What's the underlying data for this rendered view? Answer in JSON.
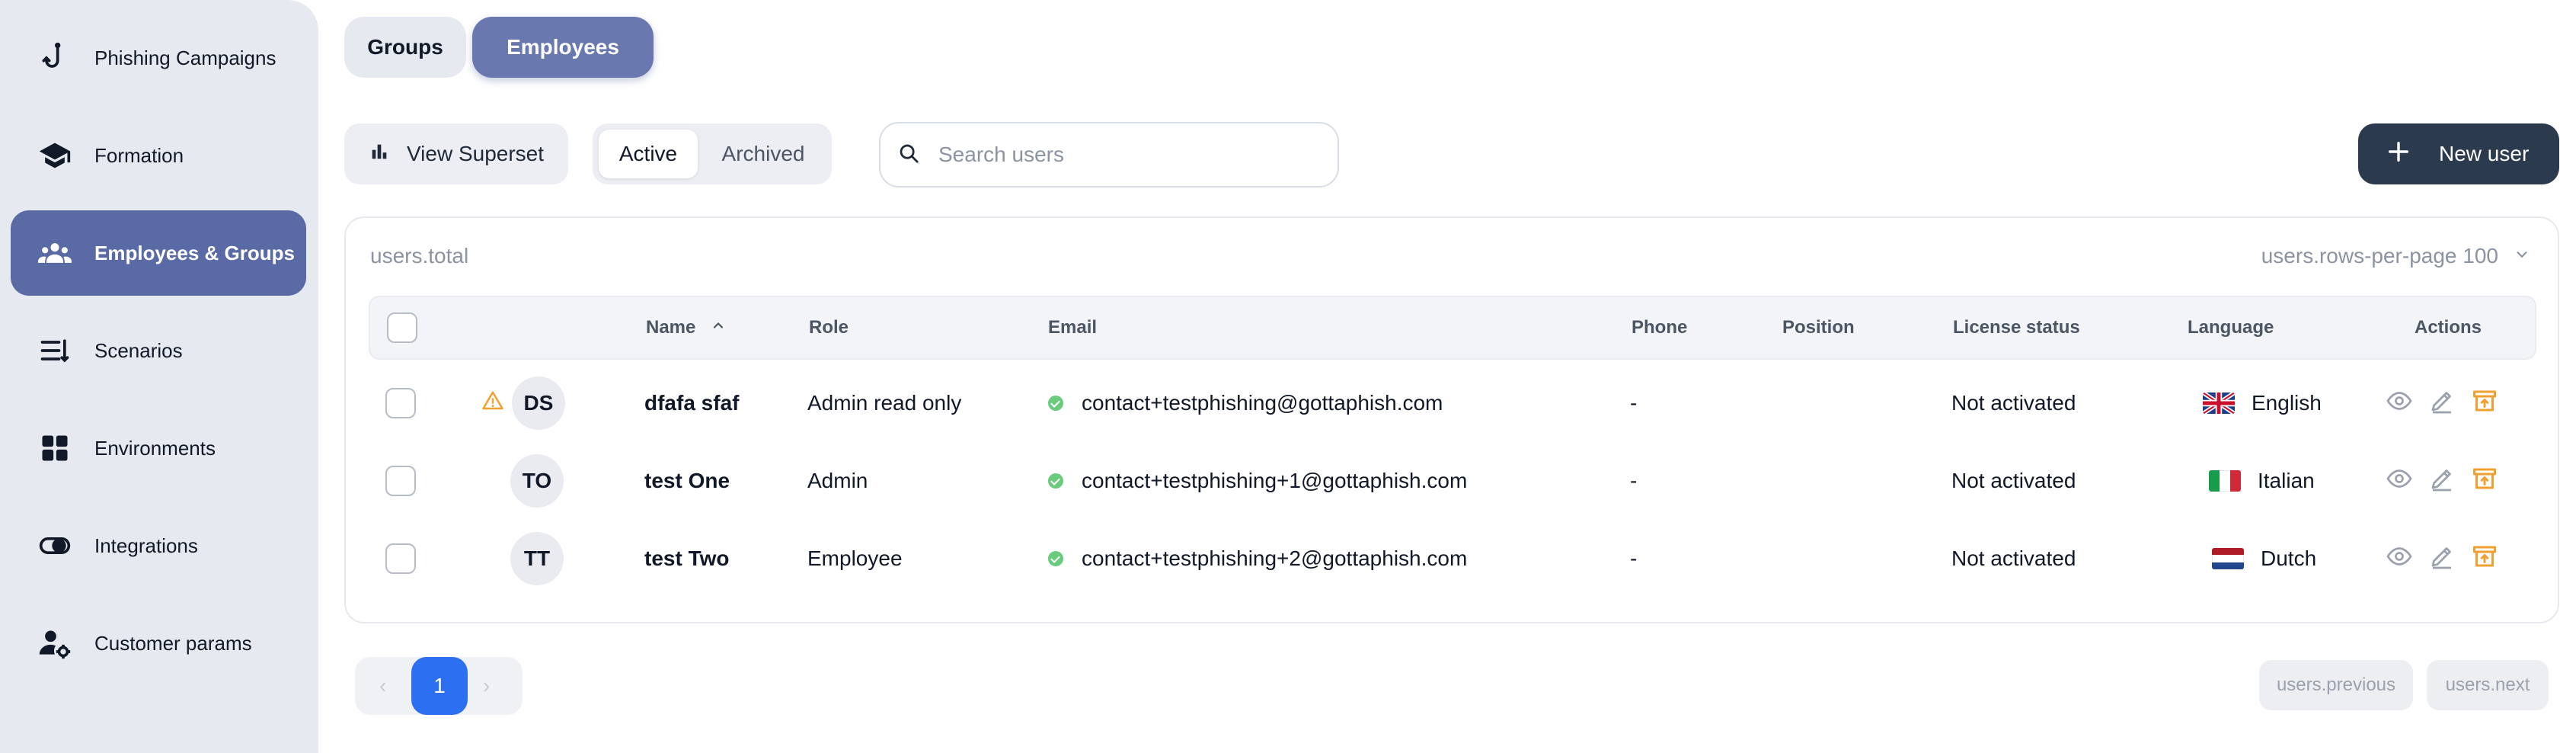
{
  "sidebar": {
    "items": [
      {
        "label": "Phishing Campaigns",
        "icon": "fish-hook-icon",
        "active": false
      },
      {
        "label": "Formation",
        "icon": "graduation-cap-icon",
        "active": false
      },
      {
        "label": "Employees & Groups",
        "icon": "people-group-icon",
        "active": true
      },
      {
        "label": "Scenarios",
        "icon": "list-icon",
        "active": false
      },
      {
        "label": "Environments",
        "icon": "grid-icon",
        "active": false
      },
      {
        "label": "Integrations",
        "icon": "toggle-icon",
        "active": false
      },
      {
        "label": "Customer params",
        "icon": "user-gear-icon",
        "active": false
      }
    ]
  },
  "tabs": {
    "groups": "Groups",
    "employees": "Employees"
  },
  "toolbar": {
    "view_superset": "View Superset",
    "filter": {
      "active": "Active",
      "archived": "Archived"
    },
    "search_placeholder": "Search users",
    "new_user": "New user"
  },
  "table": {
    "total_label": "users.total",
    "rows_per_page_label": "users.rows-per-page",
    "rows_per_page_value": "100",
    "columns": {
      "name": "Name",
      "role": "Role",
      "email": "Email",
      "phone": "Phone",
      "position": "Position",
      "license": "License status",
      "language": "Language",
      "actions": "Actions"
    },
    "rows": [
      {
        "initials": "DS",
        "warning": true,
        "name": "dfafa sfaf",
        "role": "Admin read only",
        "email": "contact+testphishing@gottaphish.com",
        "phone": "-",
        "position": "",
        "license": "Not activated",
        "language": "English",
        "flag": "uk"
      },
      {
        "initials": "TO",
        "warning": false,
        "name": "test One",
        "role": "Admin",
        "email": "contact+testphishing+1@gottaphish.com",
        "phone": "-",
        "position": "",
        "license": "Not activated",
        "language": "Italian",
        "flag": "it"
      },
      {
        "initials": "TT",
        "warning": false,
        "name": "test Two",
        "role": "Employee",
        "email": "contact+testphishing+2@gottaphish.com",
        "phone": "-",
        "position": "",
        "license": "Not activated",
        "language": "Dutch",
        "flag": "nl"
      }
    ]
  },
  "pagination": {
    "current": "1",
    "previous": "users.previous",
    "next": "users.next"
  },
  "colors": {
    "accent": "#5a6aa4",
    "primary_dark": "#2b3a4c",
    "page_active": "#2c6ff0",
    "warning": "#f0a030",
    "archive": "#f0a030",
    "success": "#6acb7d"
  }
}
